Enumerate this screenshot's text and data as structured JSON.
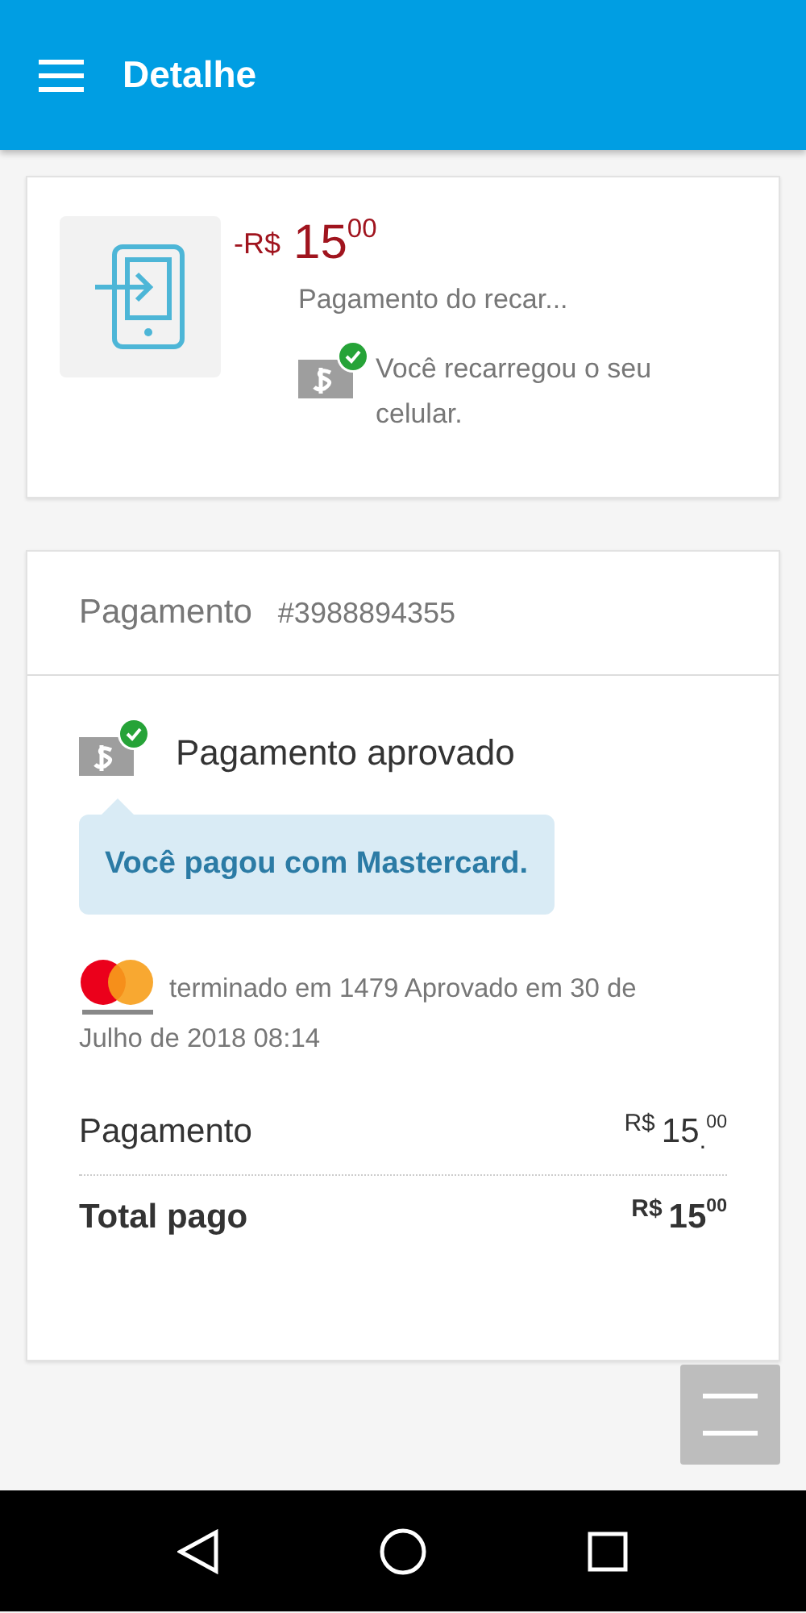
{
  "app_bar": {
    "title": "Detalhe"
  },
  "summary": {
    "currency": "-R$",
    "amount": "15$^{00}$",
    "description": "Pagamento do recar...",
    "status": "Você recarregou o seu celular."
  },
  "payment": {
    "title": "Pagamento",
    "number": "#3988894355",
    "status": "Pagamento aprovado",
    "message": "Você pagou com Mastercard.",
    "card_info": [
      "terminado em 1479 Aprovado em 30 de",
      "Julho de 2018 08:14"
    ],
    "lines": [
      {
        "kind": "normal",
        "label": "Pagamento",
        "currency": "R$",
        "amount": "15$_{.}$$^{00}$"
      },
      {
        "kind": "total",
        "label": "Total pago",
        "currency": "R$",
        "amount": "15$^{00}$"
      }
    ]
  }
}
